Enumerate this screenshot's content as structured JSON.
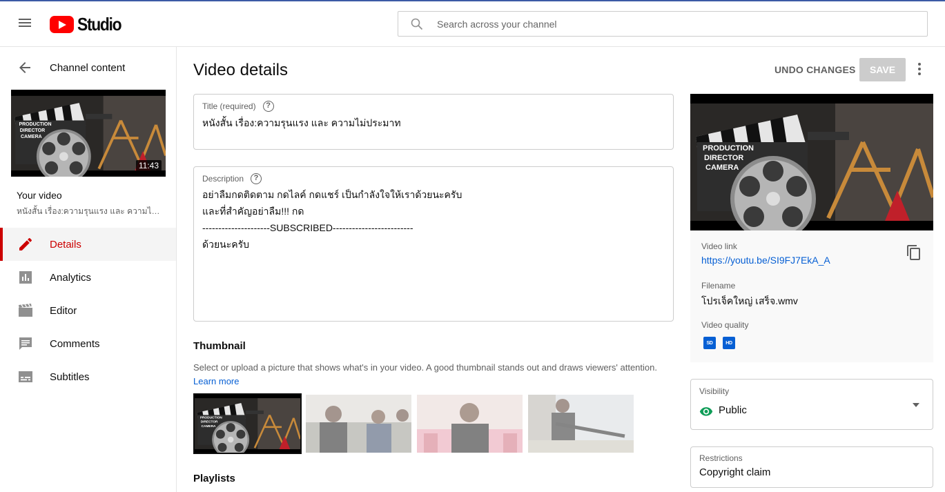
{
  "header": {
    "logo_text": "Studio",
    "search_placeholder": "Search across your channel"
  },
  "sidebar": {
    "back_label": "Channel content",
    "video_duration": "11:43",
    "your_video_label": "Your video",
    "video_title": "หนังสั้น เรื่อง:ความรุนแรง และ ความไม่ประมาท",
    "items": [
      {
        "label": "Details",
        "icon": "pencil-icon",
        "active": true
      },
      {
        "label": "Analytics",
        "icon": "analytics-icon",
        "active": false
      },
      {
        "label": "Editor",
        "icon": "clapperboard-icon",
        "active": false
      },
      {
        "label": "Comments",
        "icon": "comment-icon",
        "active": false
      },
      {
        "label": "Subtitles",
        "icon": "subtitles-icon",
        "active": false
      }
    ]
  },
  "main": {
    "page_title": "Video details",
    "undo_label": "UNDO CHANGES",
    "save_label": "SAVE",
    "title_field": {
      "label": "Title (required)",
      "value": "หนังสั้น เรื่อง:ความรุนแรง และ ความไม่ประมาท"
    },
    "description_field": {
      "label": "Description",
      "lines": [
        "อย่าลืมกดติดตาม กดไลค์ กดแชร์ เป็นกำลังใจให้เราด้วยนะครับ",
        "และที่สำคัญอย่าลืม!!! กด",
        "---------------------SUBSCRIBED-------------------------",
        "ด้วยนะครับ"
      ]
    },
    "thumbnail": {
      "heading": "Thumbnail",
      "description": "Select or upload a picture that shows what's in your video. A good thumbnail stands out and draws viewers' attention.",
      "learn_more": "Learn more"
    },
    "playlists_heading": "Playlists"
  },
  "details_card": {
    "video_link_label": "Video link",
    "video_link": "https://youtu.be/SI9FJ7EkA_A",
    "filename_label": "Filename",
    "filename": "โปรเจ็คใหญ่ เสร็จ.wmv",
    "quality_label": "Video quality",
    "quality_badges": [
      "SD",
      "HD"
    ],
    "visibility_label": "Visibility",
    "visibility_value": "Public",
    "restrictions_label": "Restrictions",
    "restrictions_value": "Copyright claim"
  },
  "colors": {
    "accent_red": "#cc0000",
    "link_blue": "#065fd4",
    "public_green": "#0f9d58"
  }
}
